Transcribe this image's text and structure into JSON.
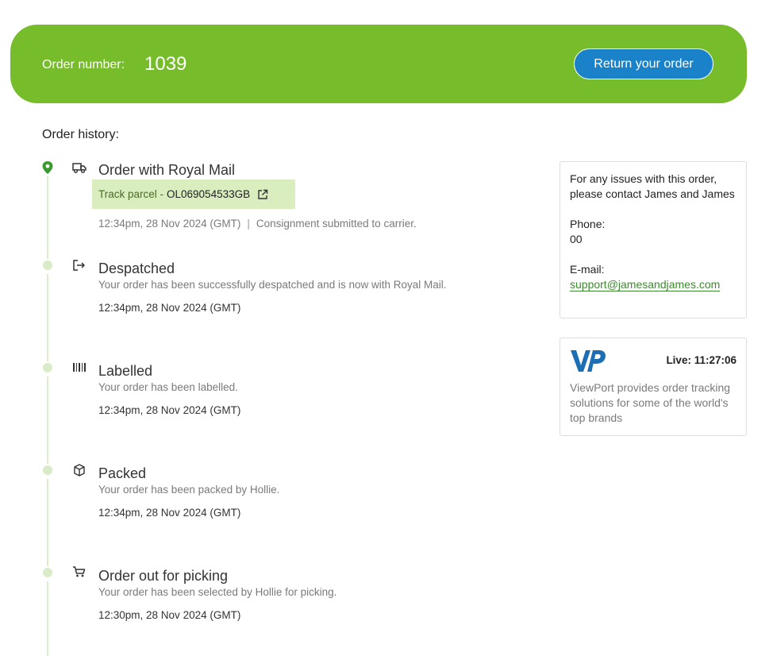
{
  "header": {
    "order_label": "Order number:",
    "order_number": "1039",
    "return_button": "Return your order",
    "brand_color": "#76bc2b",
    "button_color": "#1a82c8"
  },
  "history_label": "Order history:",
  "events": [
    {
      "icon": "truck-icon",
      "title": "Order with Royal Mail",
      "track_prefix": "Track parcel -",
      "track_code": "OL069054533GB",
      "time": "12:34pm, 28 Nov 2024 (GMT)",
      "separator": "|",
      "meta": "Consignment submitted to carrier."
    },
    {
      "icon": "exit-icon",
      "title": "Despatched",
      "desc": "Your order has been successfully despatched and is now with Royal Mail.",
      "time": "12:34pm, 28 Nov 2024 (GMT)"
    },
    {
      "icon": "barcode-icon",
      "title": "Labelled",
      "desc": "Your order has been labelled.",
      "time": "12:34pm, 28 Nov 2024 (GMT)"
    },
    {
      "icon": "package-icon",
      "title": "Packed",
      "desc": "Your order has been packed by Hollie.",
      "time": "12:34pm, 28 Nov 2024 (GMT)"
    },
    {
      "icon": "cart-icon",
      "title": "Order out for picking",
      "desc": "Your order has been selected by Hollie for picking.",
      "time": "12:30pm, 28 Nov 2024 (GMT)"
    }
  ],
  "contact": {
    "intro": "For any issues with this order, please contact James and James",
    "phone_label": "Phone:",
    "phone": "00",
    "email_label": "E-mail:",
    "email": "support@jamesandjames.com"
  },
  "viewport": {
    "logo": "VP",
    "live": "Live: 11:27:06",
    "text": "ViewPort provides order tracking solutions for some of the world's top brands"
  }
}
